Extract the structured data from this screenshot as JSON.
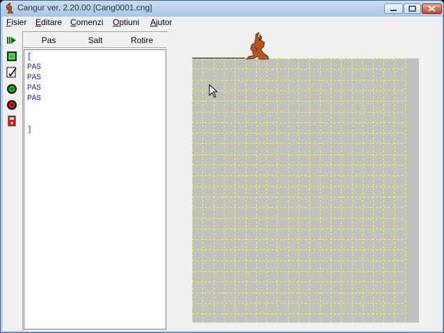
{
  "window": {
    "title": "Cangur ver. 2.20.00  [Cang0001.cng]",
    "controls": {
      "minimize": "minimize",
      "maximize": "maximize",
      "close": "close"
    }
  },
  "menu": [
    {
      "prefix": "F",
      "rest": "isier"
    },
    {
      "prefix": "E",
      "rest": "ditare"
    },
    {
      "prefix": "C",
      "rest": "omenzi"
    },
    {
      "prefix": "O",
      "rest": "ptiuni"
    },
    {
      "prefix": "A",
      "rest": "jutor"
    }
  ],
  "toolbar": [
    "run-icon",
    "stop-square-icon",
    "edit-icon",
    "green-circle-icon",
    "red-circle-icon",
    "red-device-icon"
  ],
  "columns": [
    "Pas",
    "Salt",
    "Rotire"
  ],
  "code": [
    "[",
    "PAS",
    "PAS",
    "PAS",
    "PAS",
    "",
    "",
    "]"
  ],
  "colors": {
    "code_text": "#1c1ca8",
    "grid_line": "#ffff00",
    "board": "#c0c0c0",
    "kangaroo": "#b5581e"
  }
}
